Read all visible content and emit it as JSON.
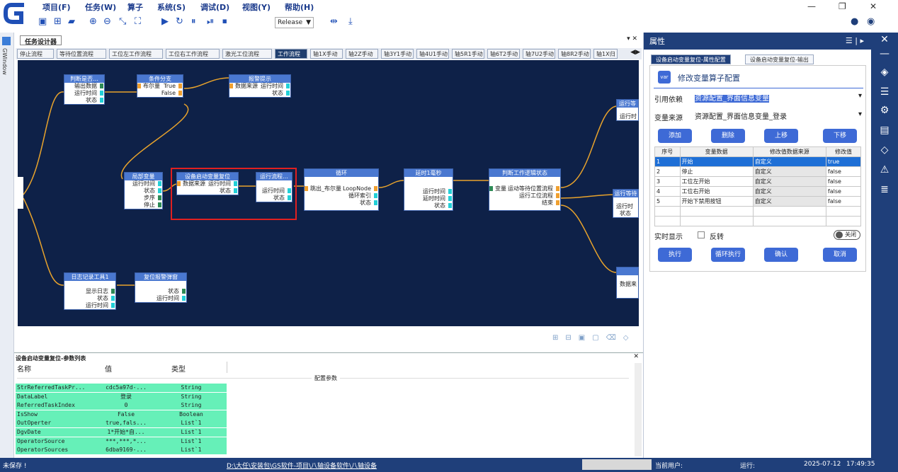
{
  "menu": [
    "项目(F)",
    "任务(W)",
    "算子",
    "系统(S)",
    "调试(D)",
    "视图(Y)",
    "帮助(H)"
  ],
  "toolbar": {
    "config": "Release"
  },
  "left_strip_label": "GWindow",
  "designer": {
    "title": "任务设计器",
    "tabs": [
      "停止流程",
      "等待位置流程",
      "工位左工作流程",
      "工位右工作流程",
      "激光工位流程",
      "工作流程",
      "轴1X手动",
      "轴2Z手动",
      "轴3Y1手动",
      "轴4U1手动",
      "轴5R1手动",
      "轴6T2手动",
      "轴7U2手动",
      "轴8R2手动",
      "轴1X归"
    ],
    "active_tab": 5
  },
  "nodes": {
    "judge": {
      "title": "判断是否…",
      "rows": [
        "输出数据",
        "运行时间",
        "状态"
      ]
    },
    "branch": {
      "title": "条件分支",
      "left": "布尔量",
      "right_true": "True",
      "right_false": "False"
    },
    "alarm": {
      "title": "报警提示",
      "left": "数据来源",
      "rows": [
        "运行时间",
        "状态"
      ]
    },
    "localvar": {
      "title": "局部变量",
      "rows": [
        "运行时间",
        "状态",
        "步序",
        "停止"
      ]
    },
    "reset": {
      "title": "设备启动变量复位",
      "left": "数据来源",
      "rows": [
        "运行时间",
        "状态"
      ]
    },
    "runflow": {
      "title": "运行流程…",
      "rows": [
        "运行时间",
        "状态"
      ]
    },
    "loop": {
      "title": "循环",
      "left": "跳出_布尔量",
      "rows": [
        "LoopNode",
        "循环索引",
        "状态"
      ]
    },
    "delay": {
      "title": "延时1毫秒",
      "rows": [
        "运行时间",
        "延时时间",
        "状态"
      ]
    },
    "judgework": {
      "title": "判断工作逻辑状态",
      "left": "变量",
      "rows": [
        "运动等待位置流程",
        "运行工位流程",
        "结束"
      ]
    },
    "log": {
      "title": "日志记录工具1",
      "rows": [
        "显示日志",
        "状态",
        "运行时间"
      ]
    },
    "alarmreset": {
      "title": "复位报警弹窗",
      "rows": [
        "状态",
        "运行时间"
      ]
    },
    "right1": {
      "title": "运行等",
      "rows": [
        "运行时"
      ]
    },
    "right2": {
      "title": "运行等待",
      "rows": [
        "运行时",
        "状态"
      ]
    },
    "right3": {
      "title": "",
      "rows": [
        "数据来"
      ]
    }
  },
  "params": {
    "title": "设备启动变量复位-参数列表",
    "headers": [
      "名称",
      "值",
      "类型"
    ],
    "section": "配置参数",
    "rows": [
      [
        "StrReferredTaskPr...",
        "cdc5a97d-...",
        "String"
      ],
      [
        "DataLabel",
        "登录",
        "String"
      ],
      [
        "ReferredTaskIndex",
        "0",
        "String"
      ],
      [
        "IsShow",
        "False",
        "Boolean"
      ],
      [
        "OutOperter",
        "true,fals...",
        "List`1"
      ],
      [
        "DgvDate",
        "1*开始*自...",
        "List`1"
      ],
      [
        "OperatorSource",
        "***,***,*...",
        "List`1"
      ],
      [
        "OperatorSources",
        "6dba9169-...",
        "List`1"
      ]
    ]
  },
  "props": {
    "title": "属性",
    "tabs": [
      "设备启动变量复位-属性配置",
      "设备启动变量复位-输出"
    ],
    "heading": "修改变量算子配置",
    "ref_label": "引用依赖",
    "ref_value": "资源配置_界面信息变量",
    "src_label": "变量来源",
    "src_value": "资源配置_界面信息变量_登录",
    "buttons": [
      "添加",
      "删除",
      "上移",
      "下移"
    ],
    "table_headers": [
      "序号",
      "变量数据",
      "修改值数据来源",
      "修改值"
    ],
    "table_rows": [
      [
        "1",
        "开始",
        "自定义",
        "true"
      ],
      [
        "2",
        "停止",
        "自定义",
        "false"
      ],
      [
        "3",
        "工位左开始",
        "自定义",
        "false"
      ],
      [
        "4",
        "工位右开始",
        "自定义",
        "false"
      ],
      [
        "5",
        "开始下禁用按钮",
        "自定义",
        "false"
      ]
    ],
    "realtime": "实时显示",
    "reverse": "反转",
    "toggle": "关闭",
    "actions": [
      "执行",
      "循环执行",
      "确认",
      "取消"
    ]
  },
  "status": {
    "unsaved": "未保存 !",
    "path": "D:\\大任\\安装包\\GS软件-项目\\八轴设备软件\\八轴设备",
    "user": "当前用户:",
    "run": "运行:",
    "date": "2025-07-12",
    "time": "17:49:35"
  },
  "colors": {
    "canvas": "#0e2148",
    "node_header": "#4a78d0",
    "accent": "#1f3f7a",
    "selected_outline": "#e02020",
    "wire": "#e8a32c"
  }
}
